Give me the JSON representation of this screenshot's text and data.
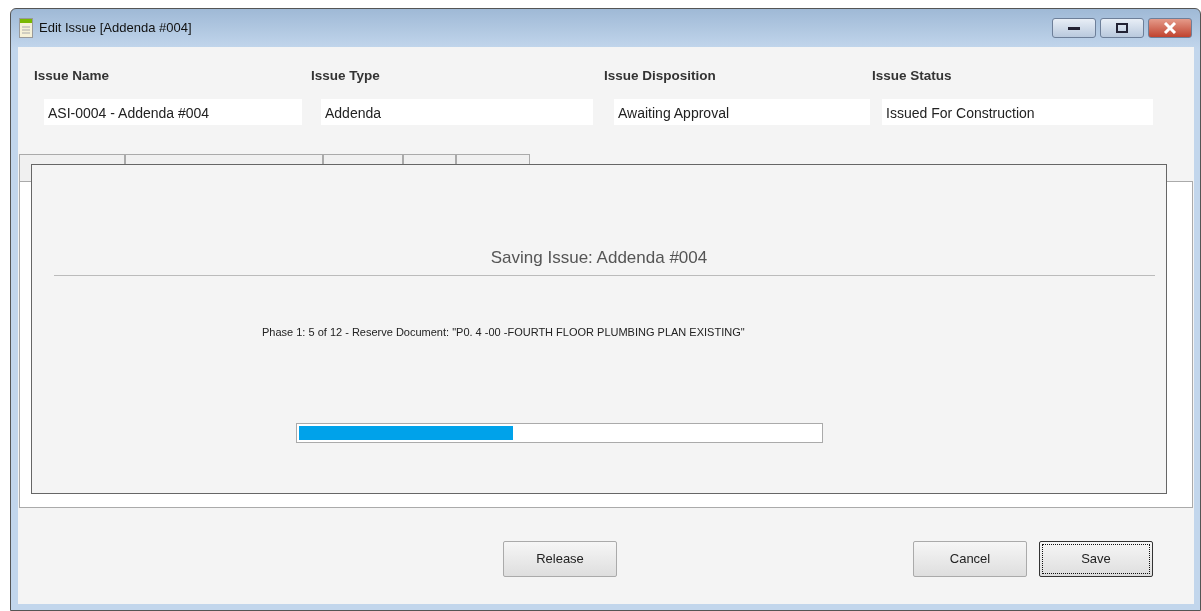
{
  "window": {
    "title": "Edit Issue [Addenda #004]"
  },
  "fields": [
    {
      "label": "Issue Name",
      "value": "ASI-0004 - Addenda #004"
    },
    {
      "label": "Issue Type",
      "value": "Addenda"
    },
    {
      "label": "Issue Disposition",
      "value": "Awaiting Approval"
    },
    {
      "label": "Issue Status",
      "value": "Issued For Construction"
    }
  ],
  "progress_dialog": {
    "title": "Saving Issue: Addenda #004",
    "message": "Phase 1: 5 of 12 - Reserve Document: \"P0. 4 -00 -FOURTH FLOOR PLUMBING PLAN EXISTING\"",
    "level": 0.41
  },
  "buttons": [
    {
      "label": "Release",
      "focused": false
    },
    {
      "label": "Cancel",
      "focused": false
    },
    {
      "label": "Save",
      "focused": true
    }
  ]
}
